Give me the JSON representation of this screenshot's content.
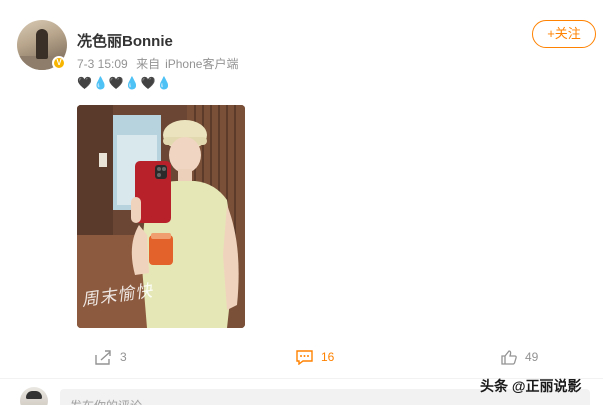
{
  "post": {
    "username": "冼色丽Bonnie",
    "time": "7-3 15:09",
    "source_prefix": "来自",
    "source_device": "iPhone客户端",
    "content": "🖤💧🖤💧🖤💧",
    "photo_watermark": "周末愉快"
  },
  "header": {
    "follow_label": "+关注"
  },
  "actions": {
    "repost_count": "3",
    "comment_count": "16",
    "like_count": "49"
  },
  "comment_box": {
    "placeholder": "发布你的评论"
  },
  "brand_watermark": "头条 @正丽说影",
  "colors": {
    "accent": "#ff8200",
    "muted": "#939393",
    "verified": "#f7b500"
  }
}
